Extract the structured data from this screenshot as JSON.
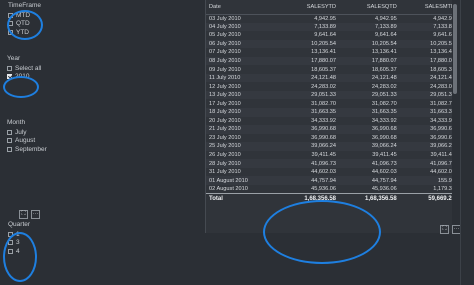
{
  "timeframe": {
    "title": "TimeFrame",
    "options": [
      {
        "label": "MTD",
        "checked": false
      },
      {
        "label": "QTD",
        "checked": false
      },
      {
        "label": "YTD",
        "checked": false
      }
    ]
  },
  "year": {
    "title": "Year",
    "options": [
      {
        "label": "Select all",
        "checked": false
      },
      {
        "label": "2010",
        "checked": true
      }
    ]
  },
  "month": {
    "title": "Month",
    "options": [
      {
        "label": "July",
        "checked": false
      },
      {
        "label": "August",
        "checked": false
      },
      {
        "label": "September",
        "checked": false
      }
    ]
  },
  "quarter": {
    "title": "Quarter",
    "options": [
      {
        "label": "1",
        "checked": false
      },
      {
        "label": "3",
        "checked": false
      },
      {
        "label": "4",
        "checked": false
      }
    ]
  },
  "icons": {
    "focus": "⛶",
    "more": "···"
  },
  "table": {
    "headers": [
      "Date",
      "SALESYTD",
      "SALESQTD",
      "SALESMTD"
    ],
    "rows": [
      [
        "03 July 2010",
        "4,942.95",
        "4,942.95",
        "4,942.95"
      ],
      [
        "04 July 2010",
        "7,133.89",
        "7,133.89",
        "7,133.89"
      ],
      [
        "05 July 2010",
        "9,641.64",
        "9,641.64",
        "9,641.64"
      ],
      [
        "06 July 2010",
        "10,205.54",
        "10,205.54",
        "10,205.54"
      ],
      [
        "07 July 2010",
        "13,136.41",
        "13,136.41",
        "13,136.41"
      ],
      [
        "08 July 2010",
        "17,880.07",
        "17,880.07",
        "17,880.07"
      ],
      [
        "09 July 2010",
        "18,605.37",
        "18,605.37",
        "18,605.37"
      ],
      [
        "11 July 2010",
        "24,121.48",
        "24,121.48",
        "24,121.48"
      ],
      [
        "12 July 2010",
        "24,283.02",
        "24,283.02",
        "24,283.02"
      ],
      [
        "13 July 2010",
        "29,051.33",
        "29,051.33",
        "29,051.33"
      ],
      [
        "17 July 2010",
        "31,082.70",
        "31,082.70",
        "31,082.70"
      ],
      [
        "18 July 2010",
        "31,663.35",
        "31,663.35",
        "31,663.35"
      ],
      [
        "20 July 2010",
        "34,333.92",
        "34,333.92",
        "34,333.92"
      ],
      [
        "21 July 2010",
        "36,990.68",
        "36,990.68",
        "36,990.68"
      ],
      [
        "23 July 2010",
        "36,990.68",
        "36,990.68",
        "36,990.68"
      ],
      [
        "25 July 2010",
        "39,066.24",
        "39,066.24",
        "39,066.24"
      ],
      [
        "26 July 2010",
        "39,411.45",
        "39,411.45",
        "39,411.45"
      ],
      [
        "28 July 2010",
        "41,096.73",
        "41,096.73",
        "41,096.73"
      ],
      [
        "31 July 2010",
        "44,602.03",
        "44,602.03",
        "44,602.03"
      ],
      [
        "01 August 2010",
        "44,757.94",
        "44,757.94",
        "155.91"
      ],
      [
        "02 August 2010",
        "45,936.06",
        "45,936.06",
        "1,179.33"
      ]
    ],
    "footer": [
      "Total",
      "1,68,356.58",
      "1,68,356.58",
      "59,669.25"
    ]
  }
}
